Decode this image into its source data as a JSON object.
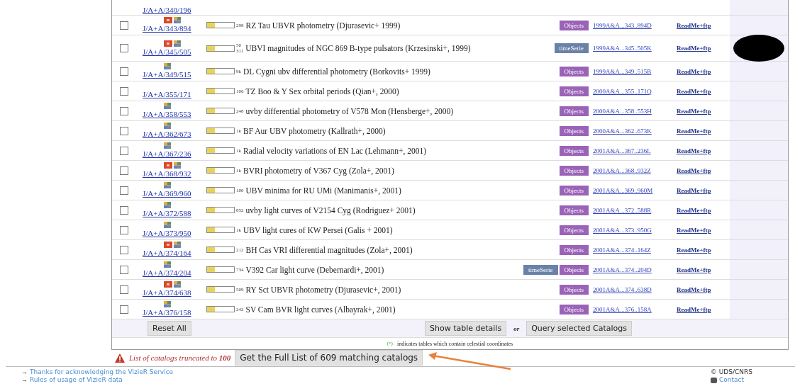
{
  "partial_row": {
    "catalog": "J/A+A/340/196"
  },
  "rows": [
    {
      "checked": false,
      "catalog": "J/A+A/343/894",
      "icons": true,
      "marked": true,
      "level": 0.3,
      "count": "298",
      "description": "RZ Tau UBVR photometry (Djurasevic+ 1999)",
      "tags": [
        {
          "kind": "objects",
          "label": "Objects"
        }
      ],
      "bibcode": "1999A&A...343..894D",
      "readme": "ReadMe+ftp"
    },
    {
      "checked": false,
      "catalog": "J/A+A/345/505",
      "icons": true,
      "marked": true,
      "level": 0.3,
      "count": "50",
      "count_extra": "311",
      "description": "UBVI magnitudes of NGC 869 B-type pulsators (Krzesinski+, 1999)",
      "tags": [
        {
          "kind": "timeserie",
          "label": "timeSerie"
        }
      ],
      "bibcode": "1999A&A...345..505K",
      "readme": "ReadMe+ftp"
    },
    {
      "checked": false,
      "catalog": "J/A+A/349/515",
      "icons": true,
      "marked": false,
      "level": 0.3,
      "count": "9k",
      "description": "DL Cygni ubv differential photometry (Borkovits+ 1999)",
      "tags": [
        {
          "kind": "objects",
          "label": "Objects"
        }
      ],
      "bibcode": "1999A&A...349..515B",
      "readme": "ReadMe+ftp"
    },
    {
      "checked": false,
      "catalog": "J/A+A/355/171",
      "icons": false,
      "level": 0.3,
      "count": "106",
      "description": "TZ Boo & Y Sex orbital periods (Qian+, 2000)",
      "tags": [
        {
          "kind": "objects",
          "label": "Objects"
        }
      ],
      "bibcode": "2000A&A...355..171Q",
      "readme": "ReadMe+ftp"
    },
    {
      "checked": false,
      "catalog": "J/A+A/358/553",
      "icons": true,
      "marked": false,
      "level": 0.3,
      "count": "248",
      "description": "uvby differential photometry of V578 Mon (Hensberge+, 2000)",
      "tags": [
        {
          "kind": "objects",
          "label": "Objects"
        }
      ],
      "bibcode": "2000A&A...358..553H",
      "readme": "ReadMe+ftp"
    },
    {
      "checked": false,
      "catalog": "J/A+A/362/673",
      "icons": true,
      "marked": false,
      "level": 0.3,
      "count": "1k",
      "description": "BF Aur UBV photometry (Kallrath+, 2000)",
      "tags": [
        {
          "kind": "objects",
          "label": "Objects"
        }
      ],
      "bibcode": "2000A&A...362..673K",
      "readme": "ReadMe+ftp"
    },
    {
      "checked": false,
      "catalog": "J/A+A/367/236",
      "icons": true,
      "marked": false,
      "level": 0.3,
      "count": "1k",
      "description": "Radial velocity variations of EN Lac (Lehmann+, 2001)",
      "tags": [
        {
          "kind": "objects",
          "label": "Objects"
        }
      ],
      "bibcode": "2001A&A...367..236L",
      "readme": "ReadMe+ftp"
    },
    {
      "checked": false,
      "catalog": "J/A+A/368/932",
      "icons": true,
      "marked": true,
      "level": 0.3,
      "count": "1k",
      "description": "BVRI photometry of V367 Cyg (Zola+, 2001)",
      "tags": [
        {
          "kind": "objects",
          "label": "Objects"
        }
      ],
      "bibcode": "2001A&A...368..932Z",
      "readme": "ReadMe+ftp"
    },
    {
      "checked": false,
      "catalog": "J/A+A/369/960",
      "icons": true,
      "marked": false,
      "level": 0.3,
      "count": "100",
      "description": "UBV minima for RU UMi (Manimanis+, 2001)",
      "tags": [
        {
          "kind": "objects",
          "label": "Objects"
        }
      ],
      "bibcode": "2001A&A...369..960M",
      "readme": "ReadMe+ftp"
    },
    {
      "checked": false,
      "catalog": "J/A+A/372/588",
      "icons": true,
      "marked": false,
      "level": 0.3,
      "count": "852",
      "description": "uvby light curves of V2154 Cyg (Rodriguez+ 2001)",
      "tags": [
        {
          "kind": "objects",
          "label": "Objects"
        }
      ],
      "bibcode": "2001A&A...372..588R",
      "readme": "ReadMe+ftp"
    },
    {
      "checked": false,
      "catalog": "J/A+A/373/950",
      "icons": true,
      "marked": false,
      "level": 0.3,
      "count": "1k",
      "description": "UBV light cures of KW Persei (Galis + 2001)",
      "tags": [
        {
          "kind": "objects",
          "label": "Objects"
        }
      ],
      "bibcode": "2001A&A...373..950G",
      "readme": "ReadMe+ftp"
    },
    {
      "checked": false,
      "catalog": "J/A+A/374/164",
      "icons": true,
      "marked": true,
      "level": 0.3,
      "count": "212",
      "description": "BH Cas VRI differential magnitudes (Zola+, 2001)",
      "tags": [
        {
          "kind": "objects",
          "label": "Objects"
        }
      ],
      "bibcode": "2001A&A...374..164Z",
      "readme": "ReadMe+ftp"
    },
    {
      "checked": false,
      "catalog": "J/A+A/374/204",
      "icons": true,
      "marked": false,
      "level": 0.3,
      "count": "734",
      "description": "V392 Car light curve (Debernardi+, 2001)",
      "tags": [
        {
          "kind": "timeserie",
          "label": "timeSerie"
        },
        {
          "kind": "objects",
          "label": "Objects"
        }
      ],
      "bibcode": "2001A&A...374..204D",
      "readme": "ReadMe+ftp"
    },
    {
      "checked": false,
      "catalog": "J/A+A/374/638",
      "icons": true,
      "marked": true,
      "level": 0.3,
      "count": "509",
      "description": "RY Sct UBVR photometry (Djurasevic+, 2001)",
      "tags": [
        {
          "kind": "objects",
          "label": "Objects"
        }
      ],
      "bibcode": "2001A&A...374..638D",
      "readme": "ReadMe+ftp"
    },
    {
      "checked": false,
      "catalog": "J/A+A/376/158",
      "icons": true,
      "marked": false,
      "level": 0.3,
      "count": "242",
      "description": "SV Cam BVR light curves (Albayrak+, 2001)",
      "tags": [
        {
          "kind": "objects",
          "label": "Objects"
        }
      ],
      "bibcode": "2001A&A...376..158A",
      "readme": "ReadMe+ftp"
    }
  ],
  "actions": {
    "reset": "Reset All",
    "details": "Show table details",
    "or": "or",
    "query": "Query selected Catalogs"
  },
  "footnote": {
    "mark": "(*)",
    "text": "indicates tables which contain celestial coordinates"
  },
  "truncation": {
    "message": "List of catalogs truncated to ",
    "limit": "100",
    "button": "Get the Full List of 609 matching catalogs"
  },
  "footer": {
    "links": [
      "Thanks for acknowledging the VizieR Service",
      "Rules of usage of VizieR data"
    ],
    "arrow": "→",
    "copyright": "© UDS/CNRS",
    "contact": "Contact"
  }
}
